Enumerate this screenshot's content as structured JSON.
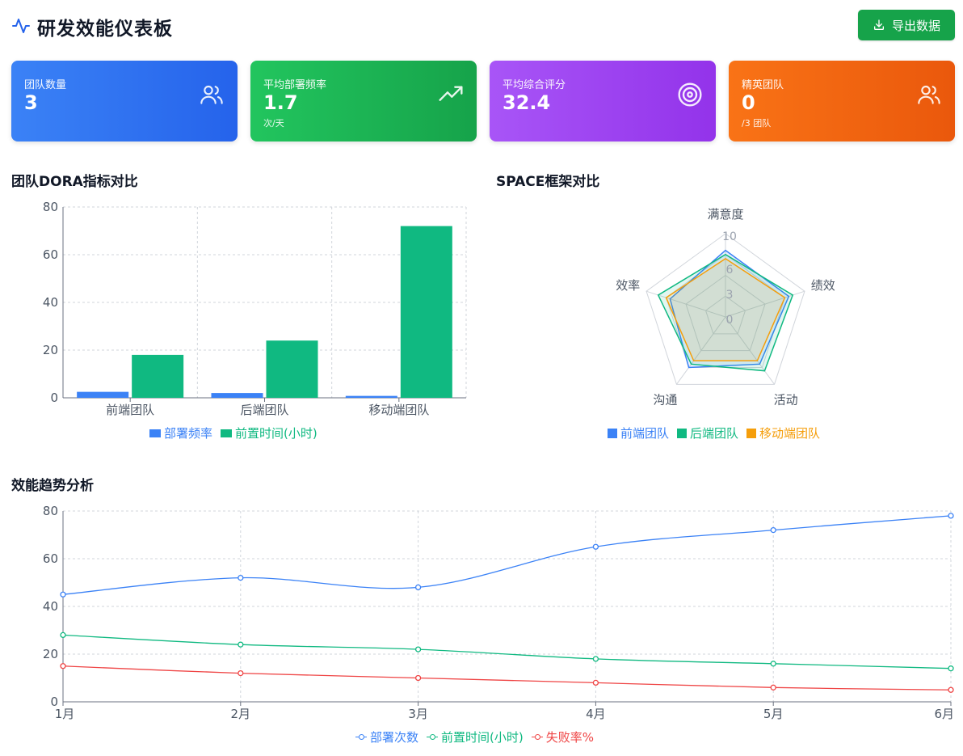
{
  "header": {
    "title": "研发效能仪表板",
    "export_label": "导出数据"
  },
  "cards": [
    {
      "label": "团队数量",
      "value": "3",
      "sub": ""
    },
    {
      "label": "平均部署频率",
      "value": "1.7",
      "sub": "次/天"
    },
    {
      "label": "平均综合评分",
      "value": "32.4",
      "sub": ""
    },
    {
      "label": "精英团队",
      "value": "0",
      "sub": "/3 团队"
    }
  ],
  "sections": {
    "dora": "团队DORA指标对比",
    "space": "SPACE框架对比",
    "trend": "效能趋势分析"
  },
  "chart_data": [
    {
      "type": "bar",
      "title": "团队DORA指标对比",
      "categories": [
        "前端团队",
        "后端团队",
        "移动端团队"
      ],
      "series": [
        {
          "name": "部署频率",
          "values": [
            2.5,
            2.0,
            0.8
          ],
          "color": "#3b82f6"
        },
        {
          "name": "前置时间(小时)",
          "values": [
            18,
            24,
            72
          ],
          "color": "#10b981"
        }
      ],
      "ylim": [
        0,
        80
      ],
      "yticks": [
        0,
        20,
        40,
        60,
        80
      ],
      "grid": true,
      "legend": "bottom"
    },
    {
      "type": "radar",
      "title": "SPACE框架对比",
      "axes": [
        "满意度",
        "绩效",
        "活动",
        "沟通",
        "效率"
      ],
      "rticks": [
        0,
        3,
        6,
        10
      ],
      "rmax": 10,
      "series": [
        {
          "name": "前端团队",
          "values": [
            8,
            8,
            7,
            7.5,
            7
          ],
          "color": "#3b82f6"
        },
        {
          "name": "后端团队",
          "values": [
            7.5,
            8.5,
            8,
            7,
            8.5
          ],
          "color": "#10b981"
        },
        {
          "name": "移动端团队",
          "values": [
            7,
            7.5,
            6.5,
            6.5,
            7.5
          ],
          "color": "#f59e0b"
        }
      ],
      "legend": "bottom"
    },
    {
      "type": "line",
      "title": "效能趋势分析",
      "categories": [
        "1月",
        "2月",
        "3月",
        "4月",
        "5月",
        "6月"
      ],
      "series": [
        {
          "name": "部署次数",
          "values": [
            45,
            52,
            48,
            65,
            72,
            78
          ],
          "color": "#3b82f6"
        },
        {
          "name": "前置时间(小时)",
          "values": [
            28,
            24,
            22,
            18,
            16,
            14
          ],
          "color": "#10b981"
        },
        {
          "name": "失败率%",
          "values": [
            15,
            12,
            10,
            8,
            6,
            5
          ],
          "color": "#ef4444"
        }
      ],
      "ylim": [
        0,
        80
      ],
      "yticks": [
        0,
        20,
        40,
        60,
        80
      ],
      "grid": true,
      "legend": "bottom"
    }
  ]
}
